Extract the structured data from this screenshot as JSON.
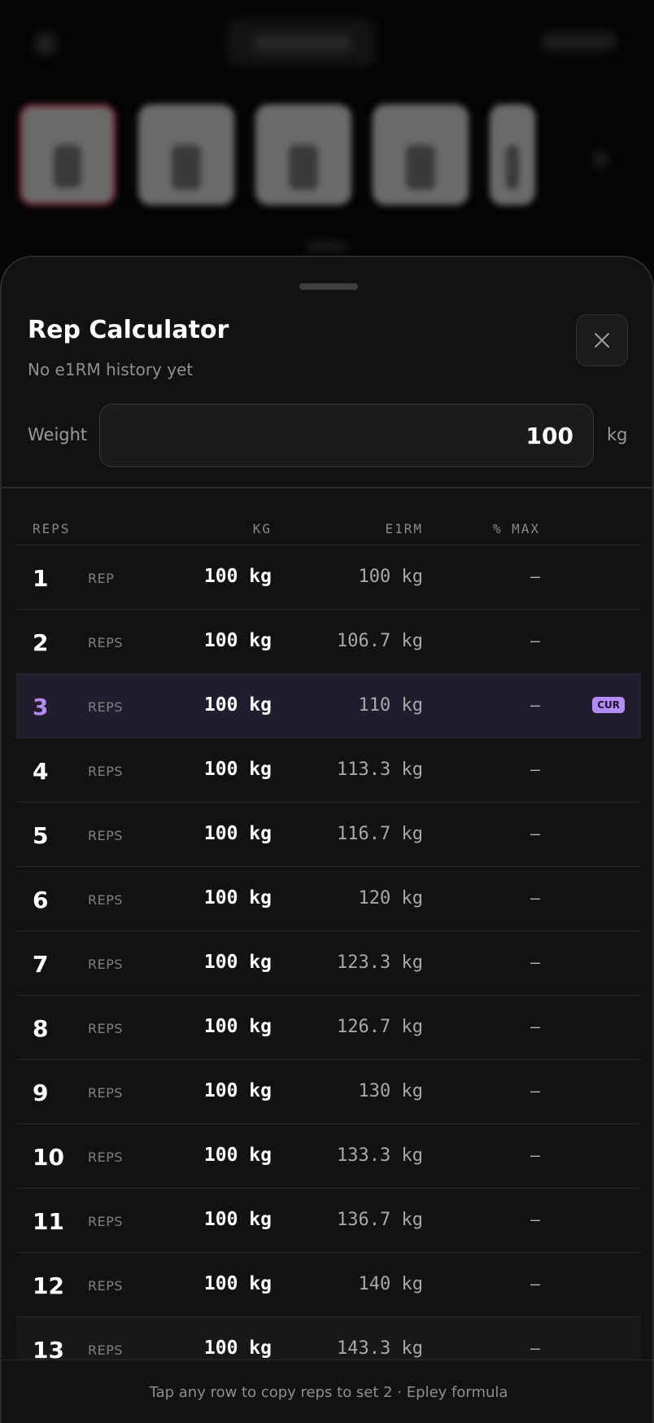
{
  "sheet": {
    "title": "Rep Calculator",
    "subtitle": "No e1RM history yet",
    "close_icon": "close-icon"
  },
  "weight": {
    "label": "Weight",
    "value": "100",
    "unit": "kg"
  },
  "table": {
    "headers": {
      "reps": "REPS",
      "kg": "KG",
      "e1rm": "E1RM",
      "pct": "% MAX"
    },
    "current_badge": "CUR",
    "rows": [
      {
        "reps": "1",
        "label": "REP",
        "kg": "100 kg",
        "e1rm": "100 kg",
        "pct": "–"
      },
      {
        "reps": "2",
        "label": "REPS",
        "kg": "100 kg",
        "e1rm": "106.7 kg",
        "pct": "–"
      },
      {
        "reps": "3",
        "label": "REPS",
        "kg": "100 kg",
        "e1rm": "110 kg",
        "pct": "–"
      },
      {
        "reps": "4",
        "label": "REPS",
        "kg": "100 kg",
        "e1rm": "113.3 kg",
        "pct": "–"
      },
      {
        "reps": "5",
        "label": "REPS",
        "kg": "100 kg",
        "e1rm": "116.7 kg",
        "pct": "–"
      },
      {
        "reps": "6",
        "label": "REPS",
        "kg": "100 kg",
        "e1rm": "120 kg",
        "pct": "–"
      },
      {
        "reps": "7",
        "label": "REPS",
        "kg": "100 kg",
        "e1rm": "123.3 kg",
        "pct": "–"
      },
      {
        "reps": "8",
        "label": "REPS",
        "kg": "100 kg",
        "e1rm": "126.7 kg",
        "pct": "–"
      },
      {
        "reps": "9",
        "label": "REPS",
        "kg": "100 kg",
        "e1rm": "130 kg",
        "pct": "–"
      },
      {
        "reps": "10",
        "label": "REPS",
        "kg": "100 kg",
        "e1rm": "133.3 kg",
        "pct": "–"
      },
      {
        "reps": "11",
        "label": "REPS",
        "kg": "100 kg",
        "e1rm": "136.7 kg",
        "pct": "–"
      },
      {
        "reps": "12",
        "label": "REPS",
        "kg": "100 kg",
        "e1rm": "140 kg",
        "pct": "–"
      },
      {
        "reps": "13",
        "label": "REPS",
        "kg": "100 kg",
        "e1rm": "143.3 kg",
        "pct": "–"
      }
    ]
  },
  "footer": {
    "text": "Tap any row to copy reps to set 2 · Epley formula"
  },
  "colors": {
    "accent": "#b48cf5",
    "sheet_bg": "#121212",
    "current_row_bg": "#211d2f"
  }
}
